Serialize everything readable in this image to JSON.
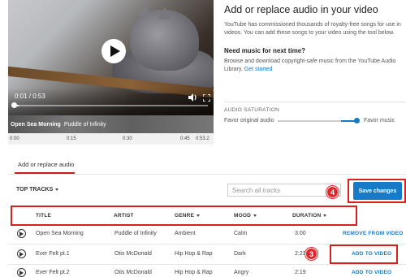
{
  "player": {
    "time_display": "0:01 / 0:53",
    "progress": 0.02,
    "track_title": "Open Sea Morning",
    "track_artist": "Puddle of Infinity",
    "timeline_ticks": [
      "0:00",
      "0:15",
      "0:30",
      "0:45",
      "0:53.2"
    ]
  },
  "panel": {
    "title": "Add or replace audio in your video",
    "description": "YouTube has commissioned thousands of royalty-free songs for use in videos. You can add these songs to your video using the tool below.",
    "subhead": "Need music for next time?",
    "description2": "Browse and download copyright-safe music from the YouTube Audio Library.",
    "link": "Get started",
    "saturation_label": "AUDIO SATURATION",
    "saturation_left": "Favor original audio",
    "saturation_right": "Favor music",
    "saturation_value": 0.95
  },
  "tabs": [
    {
      "label": "Add or replace audio"
    }
  ],
  "toolbar": {
    "top_tracks": "TOP TRACKS",
    "search_placeholder": "Search all tracks",
    "save_label": "Save changes"
  },
  "callouts": {
    "save": "4",
    "add": "3"
  },
  "table": {
    "headers": {
      "title": "TITLE",
      "artist": "ARTIST",
      "genre": "GENRE",
      "mood": "MOOD",
      "duration": "DURATION"
    },
    "rows": [
      {
        "title": "Open Sea Morning",
        "artist": "Puddle of Infinity",
        "genre": "Ambient",
        "mood": "Calm",
        "duration": "3:00",
        "action": "REMOVE FROM VIDEO"
      },
      {
        "title": "Ever Felt pt.1",
        "artist": "Otis McDonald",
        "genre": "Hip Hop & Rap",
        "mood": "Dark",
        "duration": "2:23",
        "action": "ADD TO VIDEO"
      },
      {
        "title": "Ever Felt pt.2",
        "artist": "Otis McDonald",
        "genre": "Hip Hop & Rap",
        "mood": "Angry",
        "duration": "2:19",
        "action": "ADD TO VIDEO"
      }
    ]
  },
  "colors": {
    "accent": "#167ac6",
    "highlight": "#d81e1e",
    "tab_active": "#cc181e"
  }
}
